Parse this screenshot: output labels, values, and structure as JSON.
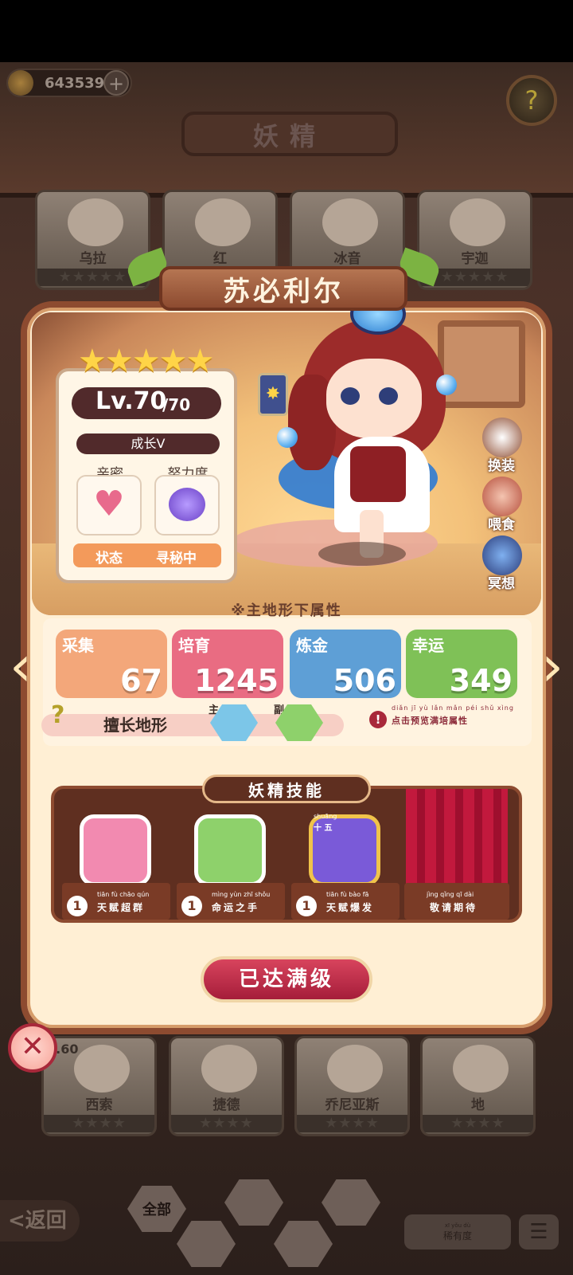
{
  "header": {
    "currency": "643539",
    "plus": "+",
    "title": "妖精",
    "help": "?"
  },
  "background_cards_top": [
    {
      "name": "乌拉",
      "stars": "★★★★★"
    },
    {
      "name": "红",
      "stars": "★★★★★"
    },
    {
      "name": "冰音",
      "stars": "★★★★★"
    },
    {
      "name": "宇迦",
      "stars": "★★★★★"
    }
  ],
  "background_cards_bottom": [
    {
      "name": "西索",
      "stars": "★★★★",
      "level": "v.60"
    },
    {
      "name": "捷德",
      "stars": "★★★★"
    },
    {
      "name": "乔尼亚斯",
      "stars": "★★★★"
    },
    {
      "name": "地",
      "stars": "★★★★"
    }
  ],
  "fairy": {
    "name": "苏必利尔",
    "stars": "★★★★★",
    "level": "Lv.70",
    "max_level": "/70",
    "growth": "成长V",
    "intimacy_label": "亲密",
    "effort_label": "努力度",
    "status_label": "状态",
    "status_value": "寻秘中"
  },
  "actions": [
    {
      "label": "换装",
      "icon": "dress-icon"
    },
    {
      "label": "喂食",
      "icon": "meat-icon"
    },
    {
      "label": "冥想",
      "icon": "meditate-icon"
    }
  ],
  "attributes": {
    "title": "※主地形下属性",
    "items": [
      {
        "name": "采集",
        "value": "67",
        "color": "#f3a77a"
      },
      {
        "name": "培育",
        "value": "1245",
        "color": "#e96c82"
      },
      {
        "name": "炼金",
        "value": "506",
        "color": "#5e9fd6"
      },
      {
        "name": "幸运",
        "value": "349",
        "color": "#7fc157"
      }
    ],
    "terrain_label": "擅长地形",
    "terrain_main": "主",
    "terrain_sub": "副",
    "terrain_hint": "?",
    "warning": "点击预览满培属性",
    "warning_pinyin": "diǎn jī yù lǎn mǎn péi shǔ xìng"
  },
  "skills": {
    "title": "妖精技能",
    "items": [
      {
        "level": "1",
        "pinyin": "tiān fù chāo qún",
        "name": "天赋超群",
        "color": "#f28ab0"
      },
      {
        "level": "1",
        "pinyin": "mìng yùn zhī shǒu",
        "name": "命运之手",
        "color": "#8ed16b"
      },
      {
        "level": "1",
        "pinyin": "tiān fù bào fā",
        "name": "天赋爆发",
        "color": "#7a5ad8",
        "badge": "十 五",
        "badge_pinyin": "shuāng"
      },
      {
        "pinyin": "jìng qǐng qī dài",
        "name": "敬请期待"
      }
    ]
  },
  "max_button": "已达满级",
  "close": "✕",
  "bottom_nav": {
    "back": "<返回",
    "all": "全部",
    "sort": "稀有度",
    "sort_pinyin": "xī yǒu dù",
    "list": "☰"
  }
}
